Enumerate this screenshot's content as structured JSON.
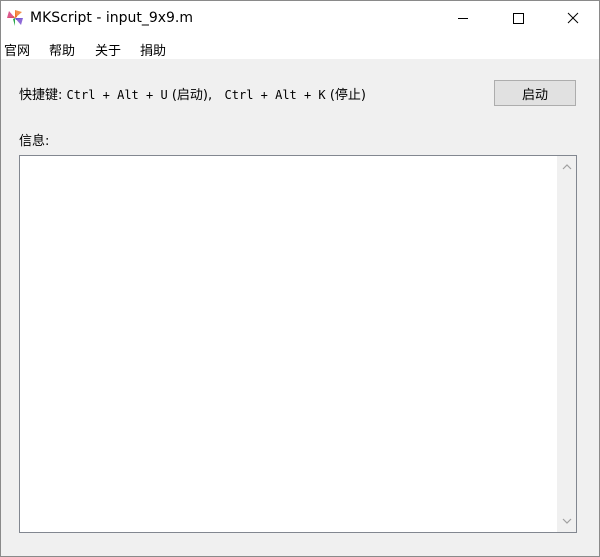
{
  "window": {
    "title": "MKScript - input_9x9.m",
    "icon": "mkscript-app-icon"
  },
  "menu": {
    "items": [
      {
        "label": "官网"
      },
      {
        "label": "帮助"
      },
      {
        "label": "关于"
      },
      {
        "label": "捐助"
      }
    ]
  },
  "hotkey": {
    "prefix": "快捷键:",
    "start_combo": "Ctrl + Alt + U",
    "start_text": "(启动),",
    "stop_combo": "Ctrl + Alt + K",
    "stop_text": "(停止)"
  },
  "start_button": {
    "label": "启动"
  },
  "info": {
    "label": "信息:",
    "content": ""
  },
  "colors": {
    "titlebar_bg": "#ffffff",
    "window_bg": "#f0f0f0",
    "button_bg": "#e1e1e1",
    "button_border": "#adadad",
    "textbox_border": "#828790"
  }
}
